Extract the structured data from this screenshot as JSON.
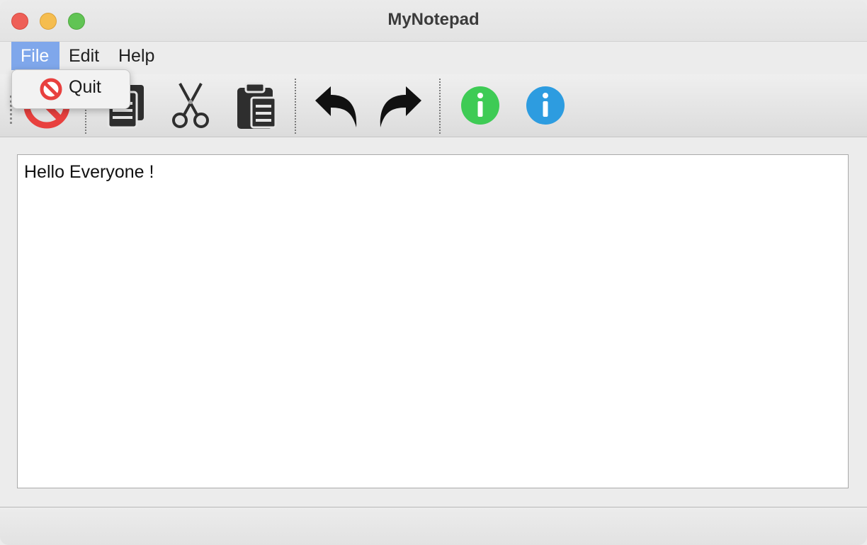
{
  "window": {
    "title": "MyNotepad"
  },
  "menubar": {
    "items": [
      {
        "label": "File",
        "active": true
      },
      {
        "label": "Edit",
        "active": false
      },
      {
        "label": "Help",
        "active": false
      }
    ]
  },
  "file_menu": {
    "items": [
      {
        "label": "Quit",
        "icon": "no-entry-icon"
      }
    ]
  },
  "toolbar": {
    "buttons": [
      {
        "icon": "quit-icon"
      },
      {
        "icon": "copy-icon"
      },
      {
        "icon": "cut-icon"
      },
      {
        "icon": "paste-icon"
      },
      {
        "icon": "undo-icon"
      },
      {
        "icon": "redo-icon"
      },
      {
        "icon": "about-icon"
      },
      {
        "icon": "about-qt-icon"
      }
    ]
  },
  "editor": {
    "text": "Hello Everyone !"
  },
  "colors": {
    "menu_highlight": "#7fa7eb",
    "quit_red": "#e8403e",
    "info_green": "#3ecb55",
    "info_blue": "#2d9ce0"
  }
}
